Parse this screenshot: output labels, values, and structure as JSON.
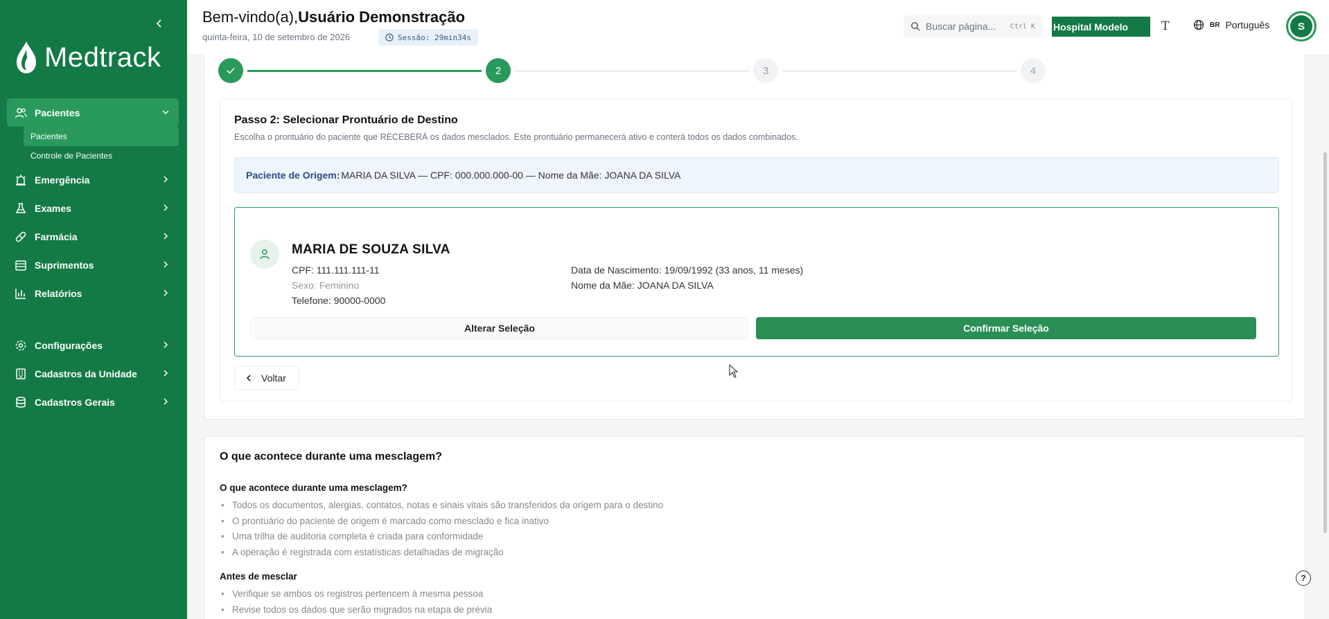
{
  "sidebar": {
    "logo_text": "Medtrack",
    "items": [
      {
        "label": "Pacientes",
        "icon": "users-icon",
        "active": true
      },
      {
        "label": "Emergência",
        "icon": "siren-icon"
      },
      {
        "label": "Exames",
        "icon": "flask-icon"
      },
      {
        "label": "Farmácia",
        "icon": "pill-icon"
      },
      {
        "label": "Suprimentos",
        "icon": "box-icon"
      },
      {
        "label": "Relatórios",
        "icon": "chart-icon"
      },
      {
        "label": "Configurações",
        "icon": "gear-icon"
      },
      {
        "label": "Cadastros da Unidade",
        "icon": "building-icon"
      },
      {
        "label": "Cadastros Gerais",
        "icon": "database-icon"
      }
    ],
    "subitems": [
      {
        "label": "Pacientes",
        "active": true
      },
      {
        "label": "Controle de Pacientes"
      }
    ]
  },
  "header": {
    "welcome_prefix": "Bem-vindo(a),",
    "user_name": "Usuário Demonstração",
    "date": "quinta-feira, 10 de setembro de 2026",
    "session": "Sessão: 29min34s",
    "search_placeholder": "Buscar página...",
    "search_shortcut": "Ctrl K",
    "hospital": "Hospital Modelo",
    "font_button": "T",
    "lang_flag": "BR",
    "lang": "Português",
    "avatar_initial": "S"
  },
  "stepper": {
    "steps": [
      "",
      "2",
      "3",
      "4"
    ]
  },
  "step_panel": {
    "title": "Passo 2: Selecionar Prontuário de Destino",
    "description": "Escolha o prontuário do paciente que RECEBERÁ os dados mesclados. Este prontuário permanecerá ativo e conterá todos os dados combinados.",
    "origin_label": "Paciente de Origem:",
    "origin_value": "MARIA DA SILVA — CPF: 000.000.000-00 — Nome da Mãe: JOANA DA SILVA",
    "patient": {
      "name": "MARIA DE SOUZA SILVA",
      "cpf": "CPF: 111.111.111-11",
      "sex": "Sexo: Feminino",
      "phone": "Telefone: 90000-0000",
      "birth": "Data de Nascimento: 19/09/1992 (33 anos, 11 meses)",
      "mother": "Nome da Mãe: JOANA DA SILVA"
    },
    "btn_change": "Alterar Seleção",
    "btn_confirm": "Confirmar Seleção",
    "btn_back": "Voltar"
  },
  "info": {
    "title": "O que acontece durante uma mesclagem?",
    "section1_title": "O que acontece durante uma mesclagem?",
    "section1_items": [
      "Todos os documentos, alergias, contatos, notas e sinais vitais são transferidos da origem para o destino",
      "O prontuário do paciente de origem é marcado como mesclado e fica inativo",
      "Uma trilha de auditoria completa é criada para conformidade",
      "A operação é registrada com estatísticas detalhadas de migração"
    ],
    "section2_title": "Antes de mesclar",
    "section2_items": [
      "Verifique se ambos os registros pertencem à mesma pessoa",
      "Revise todos os dados que serão migrados na etapa de prévia"
    ]
  },
  "colors": {
    "sidebar": "#137a45",
    "accent": "#2a9a5c",
    "origin_bg": "#eef5fc"
  }
}
